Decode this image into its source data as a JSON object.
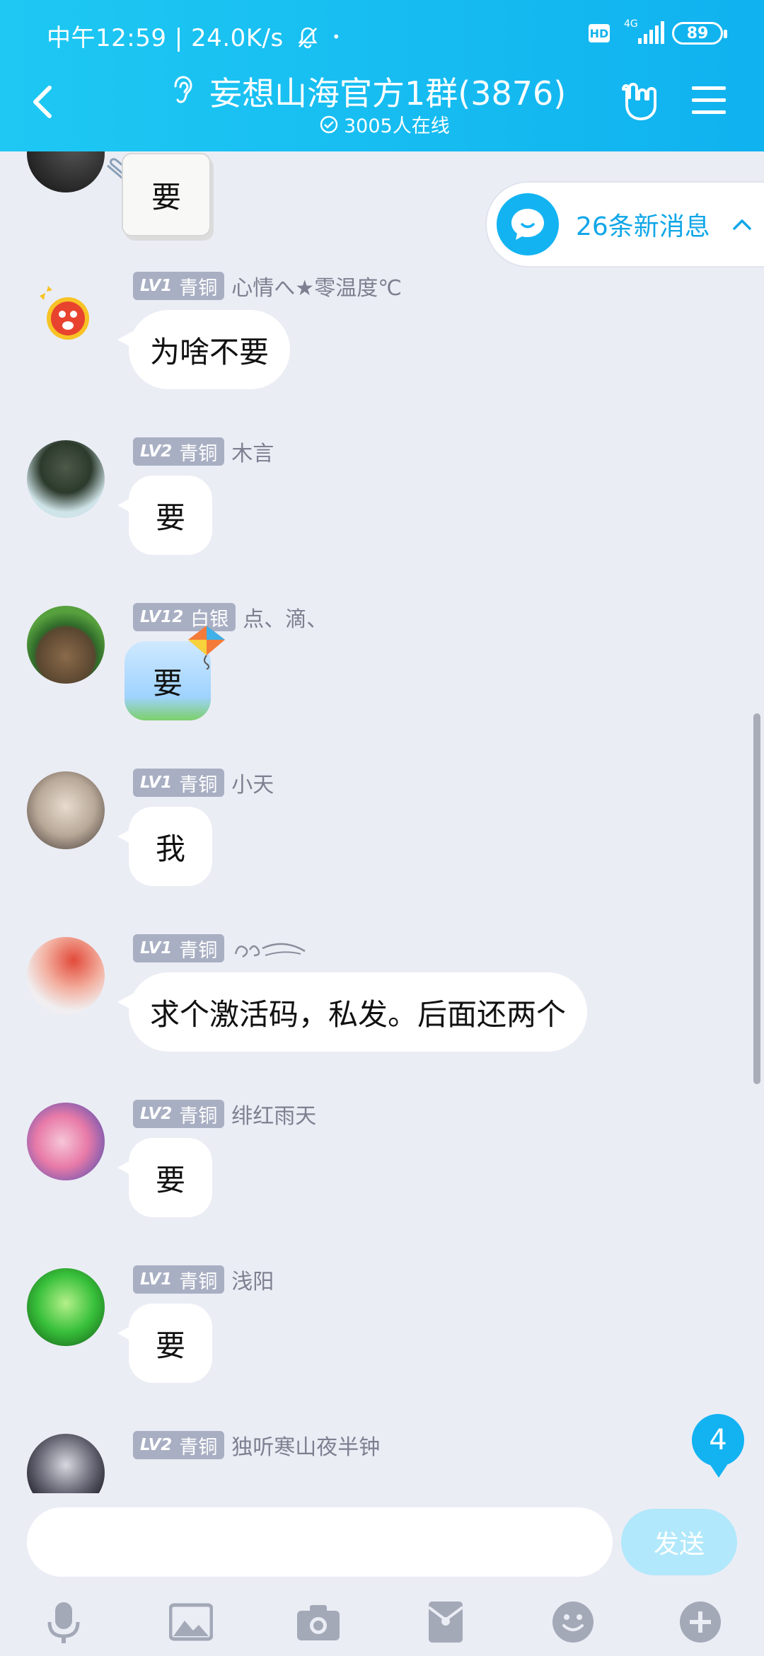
{
  "status_bar": {
    "time_speed": "中午12:59 | 24.0K/s",
    "hd": "HD",
    "network": "4G",
    "battery": "89"
  },
  "header": {
    "title": "妄想山海官方1群(3876)",
    "online": "3005人在线"
  },
  "new_messages": {
    "label": "26条新消息"
  },
  "messages": [
    {
      "id": 0,
      "text": "要"
    },
    {
      "id": 1,
      "level": "LV1",
      "rank": "青铜",
      "name": "心情へ★零温度℃",
      "text": "为啥不要"
    },
    {
      "id": 2,
      "level": "LV2",
      "rank": "青铜",
      "name": "木言",
      "text": "要"
    },
    {
      "id": 3,
      "level": "LV12",
      "rank": "白银",
      "name": "点、滴、",
      "text": "要"
    },
    {
      "id": 4,
      "level": "LV1",
      "rank": "青铜",
      "name": "小天",
      "text": "我"
    },
    {
      "id": 5,
      "level": "LV1",
      "rank": "青铜",
      "name": "",
      "text": "求个激活码，私发。后面还两个"
    },
    {
      "id": 6,
      "level": "LV2",
      "rank": "青铜",
      "name": "绯红雨天",
      "text": "要"
    },
    {
      "id": 7,
      "level": "LV1",
      "rank": "青铜",
      "name": "浅阳",
      "text": "要"
    },
    {
      "id": 8,
      "level": "LV2",
      "rank": "青铜",
      "name": "独听寒山夜半钟",
      "text": ""
    }
  ],
  "unread_count": "4",
  "composer": {
    "placeholder": "",
    "send_label": "发送"
  },
  "toolbar_icons": [
    "microphone-icon",
    "image-icon",
    "camera-icon",
    "red-packet-icon",
    "emoji-icon",
    "plus-icon"
  ],
  "colors": {
    "header": "#14bdf2",
    "accent": "#10a6e8",
    "background": "#ebedf5",
    "badge": "#a9afc3"
  }
}
